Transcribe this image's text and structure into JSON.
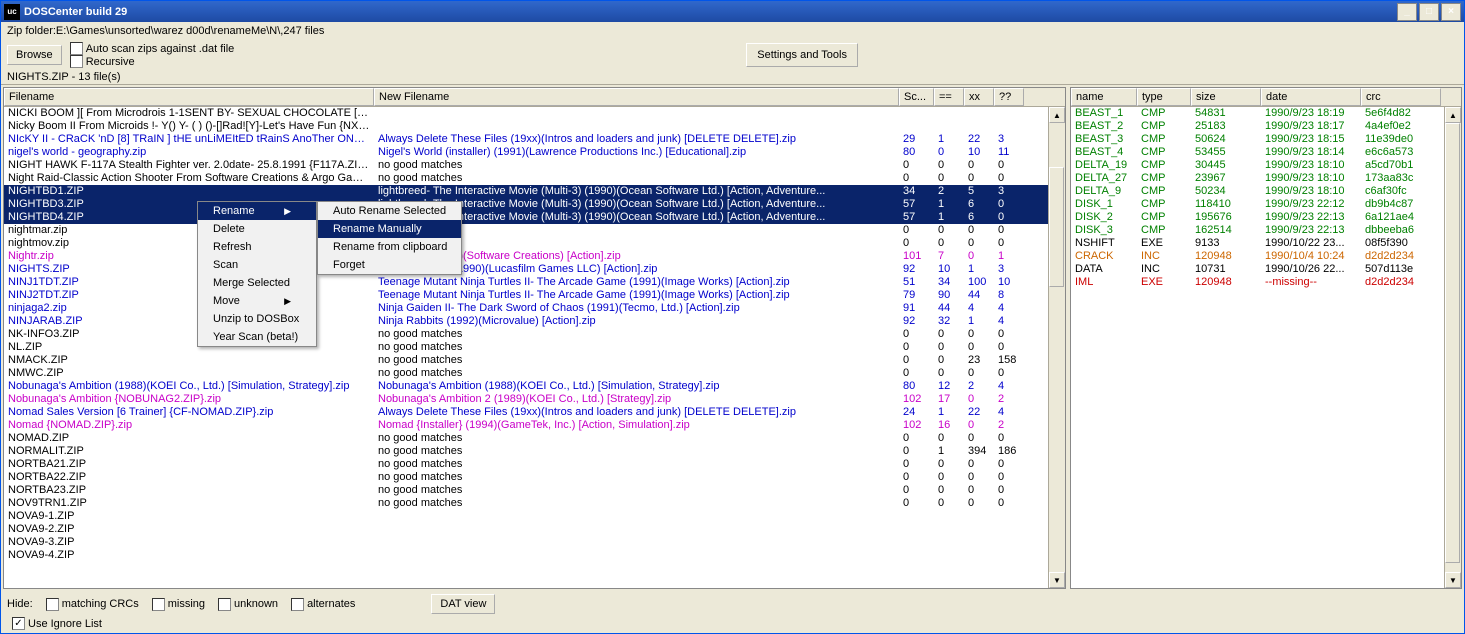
{
  "window": {
    "title": "DOSCenter build 29"
  },
  "zipPath": "Zip folder:E:\\Games\\unsorted\\warez d00d\\renameMe\\N\\,247 files",
  "toolbar": {
    "browse": "Browse",
    "autoscan": "Auto scan zips against .dat file",
    "recursive": "Recursive",
    "settings": "Settings and Tools"
  },
  "status": "NIGHTS.ZIP - 13 file(s)",
  "leftCols": [
    "Filename",
    "New Filename",
    "Sc...",
    "==",
    "xx",
    "??"
  ],
  "leftWidths": [
    370,
    525,
    35,
    30,
    30,
    30
  ],
  "leftRows": [
    {
      "sel": 0,
      "c": "black",
      "fn": "NICKI BOOM ][ From Microdrois 1-1SENT BY- SEXUAL CHOCOLATE [PE...",
      "nf": "",
      "s": "",
      "e": "",
      "x": "",
      "q": ""
    },
    {
      "sel": 0,
      "c": "black",
      "fn": "Nicky Boom II From Microids !- Y() Y-  ( ) ()-[]Rad![Y]-Let's Have Fun {NX-...",
      "nf": "",
      "s": "",
      "e": "",
      "x": "",
      "q": ""
    },
    {
      "sel": 0,
      "c": "blue",
      "fn": "NIcKY II - CRaCK 'nD [8] TRaIN ] tHE unLiMEItED tRainS AnoTher ONE ...",
      "nf": "Always Delete These Files (19xx)(Intros and loaders and junk) [DELETE DELETE].zip",
      "s": "29",
      "e": "1",
      "x": "22",
      "q": "3"
    },
    {
      "sel": 0,
      "c": "blue",
      "fn": "nigel's world - geography.zip",
      "nf": "Nigel's World (installer) (1991)(Lawrence Productions Inc.) [Educational].zip",
      "s": "80",
      "e": "0",
      "x": "10",
      "q": "11"
    },
    {
      "sel": 0,
      "c": "black",
      "fn": "NIGHT HAWK F-117A Stealth Fighter ver. 2.0date- 25.8.1991 {F117A.ZIP...",
      "nf": "no good matches",
      "s": "0",
      "e": "0",
      "x": "0",
      "q": "0"
    },
    {
      "sel": 0,
      "c": "black",
      "fn": "Night Raid-Classic Action Shooter  From Software Creations & Argo Games...",
      "nf": "no good matches",
      "s": "0",
      "e": "0",
      "x": "0",
      "q": "0"
    },
    {
      "sel": 1,
      "c": "black",
      "fn": "NIGHTBD1.ZIP",
      "nf": "lightbreed- The Interactive Movie (Multi-3) (1990)(Ocean Software Ltd.) [Action, Adventure...",
      "s": "34",
      "e": "2",
      "x": "5",
      "q": "3"
    },
    {
      "sel": 1,
      "c": "black",
      "fn": "NIGHTBD3.ZIP",
      "nf": "lightbreed- The Interactive Movie (Multi-3) (1990)(Ocean Software Ltd.) [Action, Adventure...",
      "s": "57",
      "e": "1",
      "x": "6",
      "q": "0"
    },
    {
      "sel": 1,
      "c": "black",
      "fn": "NIGHTBD4.ZIP",
      "nf": "lightbreed- The Interactive Movie (Multi-3) (1990)(Ocean Software Ltd.) [Action, Adventure...",
      "s": "57",
      "e": "1",
      "x": "6",
      "q": "0"
    },
    {
      "sel": 0,
      "c": "black",
      "fn": "nightmar.zip",
      "nf": "",
      "s": "0",
      "e": "0",
      "x": "0",
      "q": "0"
    },
    {
      "sel": 0,
      "c": "black",
      "fn": "nightmov.zip",
      "nf": "es",
      "s": "0",
      "e": "0",
      "x": "0",
      "q": "0"
    },
    {
      "sel": 0,
      "c": "mag",
      "fn": "Nightr.zip",
      "nf": "[SWR][a1] (1993)(Software Creations) [Action].zip",
      "s": "101",
      "e": "7",
      "x": "0",
      "q": "1"
    },
    {
      "sel": 0,
      "c": "blue",
      "fn": "NIGHTS.ZIP",
      "nf": "Night Shift [a2] (1990)(Lucasfilm Games LLC) [Action].zip",
      "s": "92",
      "e": "10",
      "x": "1",
      "q": "3"
    },
    {
      "sel": 0,
      "c": "blue",
      "fn": "NINJ1TDT.ZIP",
      "nf": "Teenage Mutant Ninja Turtles II- The Arcade Game (1991)(Image Works) [Action].zip",
      "s": "51",
      "e": "34",
      "x": "100",
      "q": "10"
    },
    {
      "sel": 0,
      "c": "blue",
      "fn": "NINJ2TDT.ZIP",
      "nf": "Teenage Mutant Ninja Turtles II- The Arcade Game (1991)(Image Works) [Action].zip",
      "s": "79",
      "e": "90",
      "x": "44",
      "q": "8"
    },
    {
      "sel": 0,
      "c": "blue",
      "fn": "ninjaga2.zip",
      "nf": "Ninja Gaiden II- The Dark Sword of Chaos (1991)(Tecmo, Ltd.) [Action].zip",
      "s": "91",
      "e": "44",
      "x": "4",
      "q": "4"
    },
    {
      "sel": 0,
      "c": "blue",
      "fn": "NINJARAB.ZIP",
      "nf": "Ninja Rabbits (1992)(Microvalue) [Action].zip",
      "s": "92",
      "e": "32",
      "x": "1",
      "q": "4"
    },
    {
      "sel": 0,
      "c": "black",
      "fn": "NK-INFO3.ZIP",
      "nf": "no good matches",
      "s": "0",
      "e": "0",
      "x": "0",
      "q": "0"
    },
    {
      "sel": 0,
      "c": "black",
      "fn": "NL.ZIP",
      "nf": "no good matches",
      "s": "0",
      "e": "0",
      "x": "0",
      "q": "0"
    },
    {
      "sel": 0,
      "c": "black",
      "fn": "NMACK.ZIP",
      "nf": "no good matches",
      "s": "0",
      "e": "0",
      "x": "23",
      "q": "158"
    },
    {
      "sel": 0,
      "c": "black",
      "fn": "NMWC.ZIP",
      "nf": "no good matches",
      "s": "0",
      "e": "0",
      "x": "0",
      "q": "0"
    },
    {
      "sel": 0,
      "c": "blue",
      "fn": "Nobunaga's Ambition (1988)(KOEI Co., Ltd.) [Simulation, Strategy].zip",
      "nf": "Nobunaga's Ambition (1988)(KOEI Co., Ltd.) [Simulation, Strategy].zip",
      "s": "80",
      "e": "12",
      "x": "2",
      "q": "4"
    },
    {
      "sel": 0,
      "c": "mag",
      "fn": "Nobunaga's Ambition {NOBUNAG2.ZIP}.zip",
      "nf": "Nobunaga's Ambition 2 (1989)(KOEI Co., Ltd.) [Strategy].zip",
      "s": "102",
      "e": "17",
      "x": "0",
      "q": "2"
    },
    {
      "sel": 0,
      "c": "blue",
      "fn": "Nomad Sales Version [6 Trainer]  {CF-NOMAD.ZIP}.zip",
      "nf": "Always Delete These Files (19xx)(Intros and loaders and junk) [DELETE DELETE].zip",
      "s": "24",
      "e": "1",
      "x": "22",
      "q": "4"
    },
    {
      "sel": 0,
      "c": "mag",
      "fn": "Nomad {NOMAD.ZIP}.zip",
      "nf": "Nomad {Installer} (1994)(GameTek, Inc.) [Action, Simulation].zip",
      "s": "102",
      "e": "16",
      "x": "0",
      "q": "2"
    },
    {
      "sel": 0,
      "c": "black",
      "fn": "NOMAD.ZIP",
      "nf": "no good matches",
      "s": "0",
      "e": "0",
      "x": "0",
      "q": "0"
    },
    {
      "sel": 0,
      "c": "black",
      "fn": "NORMALIT.ZIP",
      "nf": "no good matches",
      "s": "0",
      "e": "1",
      "x": "394",
      "q": "186"
    },
    {
      "sel": 0,
      "c": "black",
      "fn": "NORTBA21.ZIP",
      "nf": "no good matches",
      "s": "0",
      "e": "0",
      "x": "0",
      "q": "0"
    },
    {
      "sel": 0,
      "c": "black",
      "fn": "NORTBA22.ZIP",
      "nf": "no good matches",
      "s": "0",
      "e": "0",
      "x": "0",
      "q": "0"
    },
    {
      "sel": 0,
      "c": "black",
      "fn": "NORTBA23.ZIP",
      "nf": "no good matches",
      "s": "0",
      "e": "0",
      "x": "0",
      "q": "0"
    },
    {
      "sel": 0,
      "c": "black",
      "fn": "NOV9TRN1.ZIP",
      "nf": "no good matches",
      "s": "0",
      "e": "0",
      "x": "0",
      "q": "0"
    },
    {
      "sel": 0,
      "c": "black",
      "fn": "NOVA9-1.ZIP",
      "nf": "",
      "s": "",
      "e": "",
      "x": "",
      "q": ""
    },
    {
      "sel": 0,
      "c": "black",
      "fn": "NOVA9-2.ZIP",
      "nf": "",
      "s": "",
      "e": "",
      "x": "",
      "q": ""
    },
    {
      "sel": 0,
      "c": "black",
      "fn": "NOVA9-3.ZIP",
      "nf": "",
      "s": "",
      "e": "",
      "x": "",
      "q": ""
    },
    {
      "sel": 0,
      "c": "black",
      "fn": "NOVA9-4.ZIP",
      "nf": "",
      "s": "",
      "e": "",
      "x": "",
      "q": ""
    }
  ],
  "rightCols": [
    "name",
    "type",
    "size",
    "date",
    "crc"
  ],
  "rightWidths": [
    66,
    54,
    70,
    100,
    80
  ],
  "rightRows": [
    {
      "c": "green",
      "n": "BEAST_1",
      "t": "CMP",
      "s": "54831",
      "d": "1990/9/23 18:19",
      "crc": "5e6f4d82"
    },
    {
      "c": "green",
      "n": "BEAST_2",
      "t": "CMP",
      "s": "25183",
      "d": "1990/9/23 18:17",
      "crc": "4a4ef0e2"
    },
    {
      "c": "green",
      "n": "BEAST_3",
      "t": "CMP",
      "s": "50624",
      "d": "1990/9/23 18:15",
      "crc": "11e39de0"
    },
    {
      "c": "green",
      "n": "BEAST_4",
      "t": "CMP",
      "s": "53455",
      "d": "1990/9/23 18:14",
      "crc": "e6c6a573"
    },
    {
      "c": "green",
      "n": "DELTA_19",
      "t": "CMP",
      "s": "30445",
      "d": "1990/9/23 18:10",
      "crc": "a5cd70b1"
    },
    {
      "c": "green",
      "n": "DELTA_27",
      "t": "CMP",
      "s": "23967",
      "d": "1990/9/23 18:10",
      "crc": "173aa83c"
    },
    {
      "c": "green",
      "n": "DELTA_9",
      "t": "CMP",
      "s": "50234",
      "d": "1990/9/23 18:10",
      "crc": "c6af30fc"
    },
    {
      "c": "green",
      "n": "DISK_1",
      "t": "CMP",
      "s": "118410",
      "d": "1990/9/23 22:12",
      "crc": "db9b4c87"
    },
    {
      "c": "green",
      "n": "DISK_2",
      "t": "CMP",
      "s": "195676",
      "d": "1990/9/23 22:13",
      "crc": "6a121ae4"
    },
    {
      "c": "green",
      "n": "DISK_3",
      "t": "CMP",
      "s": "162514",
      "d": "1990/9/23 22:13",
      "crc": "dbbeeba6"
    },
    {
      "c": "black",
      "n": "NSHIFT",
      "t": "EXE",
      "s": "9133",
      "d": "1990/10/22 23...",
      "crc": "08f5f390"
    },
    {
      "c": "orange",
      "n": "CRACK",
      "t": "INC",
      "s": "120948",
      "d": "1990/10/4 10:24",
      "crc": "d2d2d234"
    },
    {
      "c": "black",
      "n": "DATA",
      "t": "INC",
      "s": "10731",
      "d": "1990/10/26 22...",
      "crc": "507d113e"
    },
    {
      "c": "red",
      "n": "IML",
      "t": "EXE",
      "s": "120948",
      "d": "--missing--",
      "crc": "d2d2d234"
    }
  ],
  "ctx1": [
    "Rename",
    "Delete",
    "Refresh",
    "Scan",
    "Merge Selected",
    "Move",
    "Unzip to DOSBox",
    "Year Scan (beta!)"
  ],
  "ctx2": [
    "Auto Rename Selected",
    "Rename Manually",
    "Rename from clipboard",
    "Forget"
  ],
  "bottom": {
    "hide": "Hide:",
    "matchcrc": "matching CRCs",
    "missing": "missing",
    "unknown": "unknown",
    "alternates": "alternates",
    "datview": "DAT view",
    "useignore": "Use Ignore List"
  }
}
